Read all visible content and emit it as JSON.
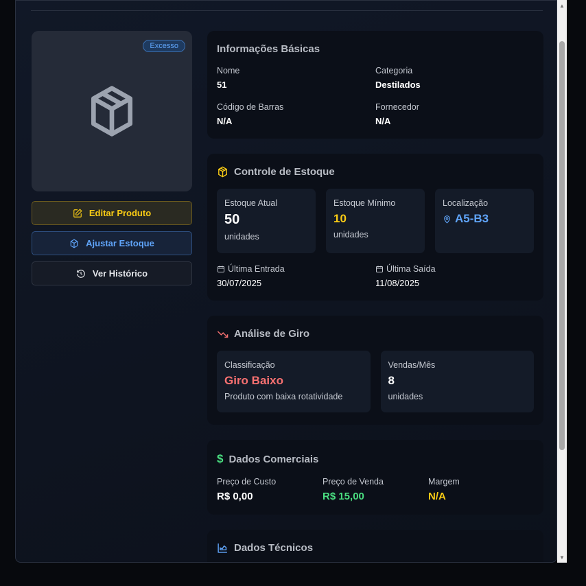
{
  "product": {
    "badge": "Excesso",
    "icon": "package-icon"
  },
  "actions": {
    "edit": "Editar Produto",
    "adjust": "Ajustar Estoque",
    "history": "Ver Histórico"
  },
  "basic": {
    "title": "Informações Básicas",
    "name_label": "Nome",
    "name": "51",
    "category_label": "Categoria",
    "category": "Destilados",
    "barcode_label": "Código de Barras",
    "barcode": "N/A",
    "supplier_label": "Fornecedor",
    "supplier": "N/A"
  },
  "stock": {
    "title": "Controle de Estoque",
    "current_label": "Estoque Atual",
    "current": "50",
    "current_unit": "unidades",
    "min_label": "Estoque Mínimo",
    "min": "10",
    "min_unit": "unidades",
    "location_label": "Localização",
    "location": "A5-B3",
    "last_in_label": "Última Entrada",
    "last_in": "30/07/2025",
    "last_out_label": "Última Saída",
    "last_out": "11/08/2025"
  },
  "turnover": {
    "title": "Análise de Giro",
    "class_label": "Classificação",
    "class": "Giro Baixo",
    "class_desc": "Produto com baixa rotatividade",
    "sales_label": "Vendas/Mês",
    "sales": "8",
    "sales_unit": "unidades"
  },
  "commercial": {
    "title": "Dados Comerciais",
    "cost_label": "Preço de Custo",
    "cost": "R$ 0,00",
    "price_label": "Preço de Venda",
    "price": "R$ 15,00",
    "margin_label": "Margem",
    "margin": "N/A"
  },
  "technical": {
    "title": "Dados Técnicos"
  },
  "colors": {
    "yellow": "#facc15",
    "blue": "#60a5fa",
    "red": "#f87171",
    "green": "#4ade80"
  }
}
